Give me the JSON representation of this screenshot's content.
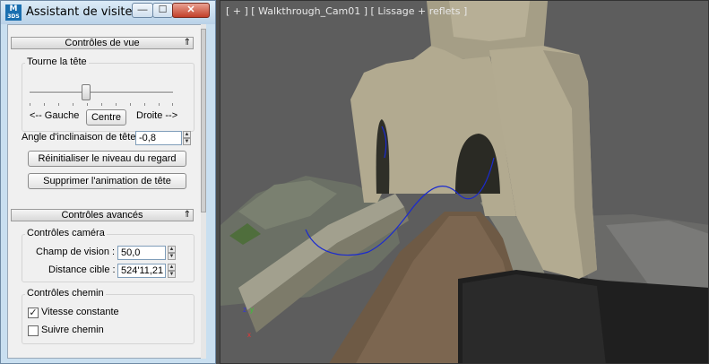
{
  "window": {
    "title": "Assistant de visite ...",
    "icon_text_top": "M",
    "icon_text_bottom": "3DS",
    "btn_minimize": "—",
    "btn_maximize": "☐",
    "btn_close": "✕"
  },
  "view_controls": {
    "header": "Contrôles de vue",
    "caret": "⇑",
    "group_label": "Tourne la tête",
    "slider_level": 0.5,
    "left_label": "<-- Gauche",
    "center_button": "Centre",
    "right_label": "Droite -->",
    "tilt_label": "Angle d'inclinaison de tête",
    "tilt_value": "-0,8",
    "reset_button": "Réinitialiser le niveau du regard",
    "delete_anim_button": "Supprimer l'animation de tête"
  },
  "advanced_controls": {
    "header": "Contrôles avancés",
    "caret": "⇑",
    "camera_group": "Contrôles caméra",
    "fov_label": "Champ de vision :",
    "fov_value": "50,0",
    "target_label": "Distance cible :",
    "target_value": "524'11,21",
    "path_group": "Contrôles chemin",
    "constant_speed_label": "Vitesse constante",
    "constant_speed_checked": true,
    "follow_path_label": "Suivre chemin",
    "follow_path_checked": false
  },
  "viewport": {
    "label": "[ + ] [ Walkthrough_Cam01 ] [ Lissage + reflets ]"
  }
}
